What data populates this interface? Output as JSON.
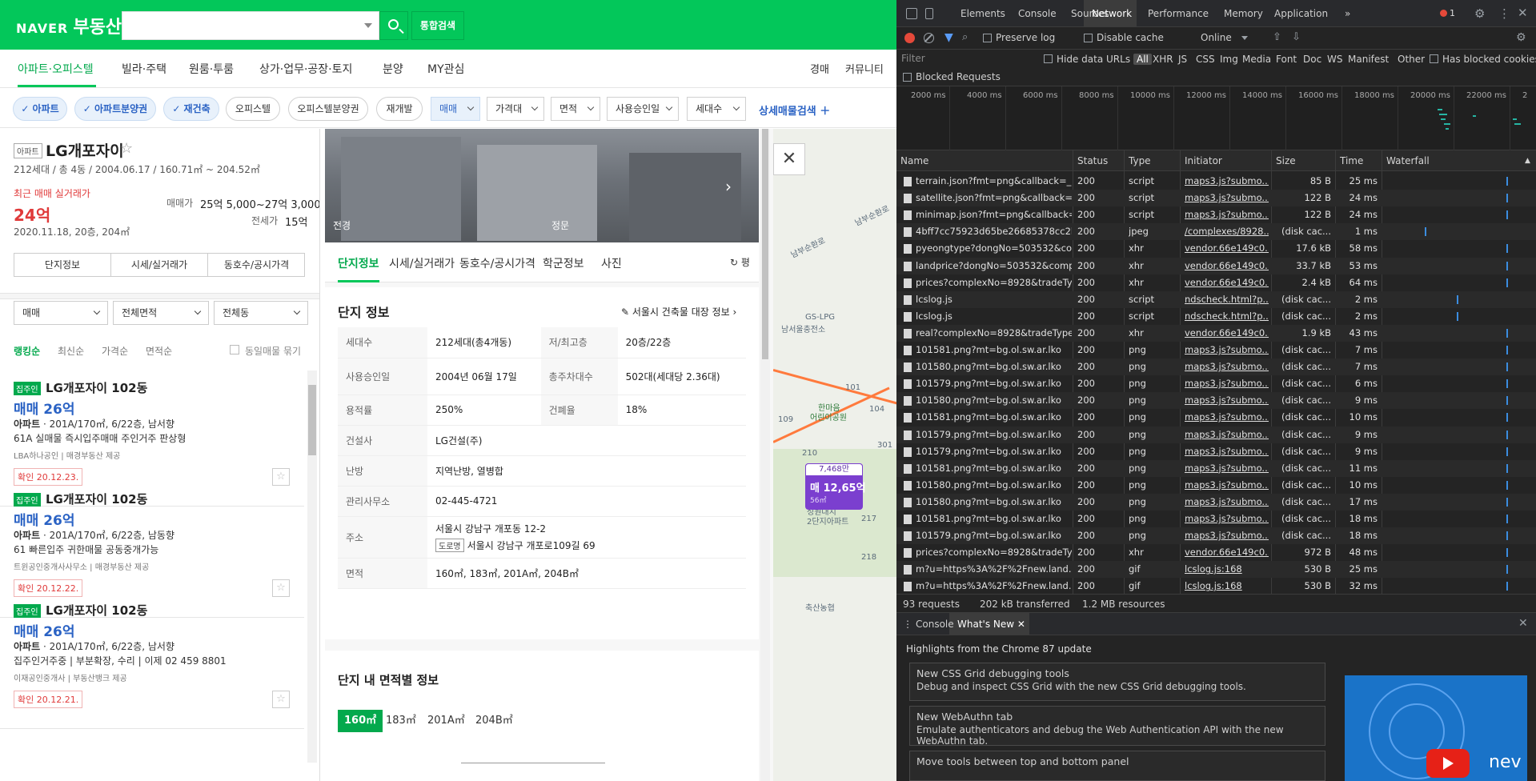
{
  "header": {
    "logo_naver": "NAVER",
    "logo_service": "부동산",
    "search_placeholder": "",
    "unified_search": "통합검색"
  },
  "nav": {
    "tabs": [
      "아파트·오피스텔",
      "빌라·주택",
      "원룸·투룸",
      "상가·업무·공장·토지",
      "분양",
      "MY관심"
    ],
    "right": [
      "경매",
      "커뮤니티"
    ]
  },
  "filters": {
    "chips": [
      {
        "label": "아파트",
        "on": true
      },
      {
        "label": "아파트분양권",
        "on": true
      },
      {
        "label": "재건축",
        "on": true
      },
      {
        "label": "오피스텔",
        "on": false
      },
      {
        "label": "오피스텔분양권",
        "on": false
      },
      {
        "label": "재개발",
        "on": false
      }
    ],
    "dropdowns": [
      "매매",
      "가격대",
      "면적",
      "사용승인일",
      "세대수"
    ],
    "detail_search": "상세매물검색"
  },
  "complex": {
    "badge": "아파트",
    "name": "LG개포자이",
    "info": "212세대 / 총 4동 / 2004.06.17 / 160.71㎡ ~ 204.52㎡",
    "recent_label": "최근 매매 실거래가",
    "recent_price": "24억",
    "recent_date": "2020.11.18, 20층, 204㎡",
    "sale_label": "매매가",
    "sale_value": "25억 5,000~27억 3,000",
    "jeonse_label": "전세가",
    "jeonse_value": "15억",
    "info_tabs": [
      "단지정보",
      "시세/실거래가",
      "동호수/공시가격"
    ]
  },
  "list_filters": {
    "selects": [
      "매매",
      "전체면적",
      "전체동"
    ],
    "sorts": [
      "랭킹순",
      "최신순",
      "가격순",
      "면적순"
    ],
    "same_label": "동일매물 묶기"
  },
  "listings": [
    {
      "badge": "집주인",
      "title": "LG개포자이 102동",
      "price": "매매 26억",
      "spec_type": "아파트",
      "spec": " · 201A/170㎡, 6/22층, 남서향",
      "desc": "61A 실매물 즉시입주매매 주인거주 판상형",
      "agent": "LBA하나공인 | 매경부동산 제공",
      "confirm": "확인 20.12.23."
    },
    {
      "badge": "집주인",
      "title": "LG개포자이 102동",
      "price": "매매 26억",
      "spec_type": "아파트",
      "spec": " · 201A/170㎡, 6/22층, 남동향",
      "desc": "61 빠른입주 귀한매물 공동중개가능",
      "agent": "트윈공인중개사사무소 | 매경부동산 제공",
      "confirm": "확인 20.12.22."
    },
    {
      "badge": "집주인",
      "title": "LG개포자이 102동",
      "price": "매매 26억",
      "spec_type": "아파트",
      "spec": " · 201A/170㎡, 6/22층, 남서향",
      "desc": "집주인거주중 | 부분확장, 수리 | 이제 02 459 8801",
      "agent": "이재공인중개사 | 부동산뱅크 제공",
      "confirm": "확인 20.12.21."
    }
  ],
  "detail": {
    "photo_labels": [
      "전경",
      "정문"
    ],
    "tabs": [
      "단지정보",
      "시세/실거래가",
      "동호수/공시가격",
      "학군정보",
      "사진"
    ],
    "refresh": "평",
    "section_title": "단지 정보",
    "section_link": "서울시 건축물 대장 정보",
    "rows": [
      {
        "k": "세대수",
        "v": "212세대(총4개동)",
        "k2": "저/최고층",
        "v2": "20층/22층"
      },
      {
        "k": "사용승인일",
        "v": "2004년 06월 17일",
        "k2": "총주차대수",
        "v2": "502대(세대당 2.36대)"
      },
      {
        "k": "용적률",
        "v": "250%",
        "k2": "건폐율",
        "v2": "18%"
      },
      {
        "k": "건설사",
        "v": "LG건설(주)"
      },
      {
        "k": "난방",
        "v": "지역난방, 열병합"
      },
      {
        "k": "관리사무소",
        "v": "02-445-4721"
      },
      {
        "k": "주소",
        "v": "서울시 강남구 개포동 12-2",
        "road_badge": "도로명",
        "road": "서울시 강남구 개포로109길 69"
      },
      {
        "k": "면적",
        "v": "160㎡, 183㎡, 201A㎡, 204B㎡"
      }
    ],
    "area_title": "단지 내 면적별 정보",
    "area_tabs": [
      "160㎡",
      "183㎡",
      "201A㎡",
      "204B㎡"
    ]
  },
  "map": {
    "labels": [
      "남부순환로",
      "남부순환로",
      "GS-LPG",
      "남서울충전소",
      "101",
      "한마음",
      "어린이공원",
      "104",
      "109",
      "210",
      "301",
      "성원대치",
      "2단지아파트",
      "217",
      "218",
      "축산농협"
    ],
    "marker_top": "7,468만",
    "marker_price": "매 12,65억",
    "marker_area": "56㎡"
  },
  "devtools": {
    "tabs": [
      "Elements",
      "Console",
      "Sources",
      "Network",
      "Performance",
      "Memory",
      "Application"
    ],
    "active_tab": "Network",
    "error_count": "1",
    "toolbar": {
      "preserve_log": "Preserve log",
      "disable_cache": "Disable cache",
      "throttle": "Online"
    },
    "filterbar": {
      "placeholder": "Filter",
      "hide_data_urls": "Hide data URLs",
      "types": [
        "All",
        "XHR",
        "JS",
        "CSS",
        "Img",
        "Media",
        "Font",
        "Doc",
        "WS",
        "Manifest",
        "Other"
      ],
      "has_blocked": "Has blocked cookies"
    },
    "blocked_requests": "Blocked Requests",
    "overview_ticks": [
      "2000 ms",
      "4000 ms",
      "6000 ms",
      "8000 ms",
      "10000 ms",
      "12000 ms",
      "14000 ms",
      "16000 ms",
      "18000 ms",
      "20000 ms",
      "22000 ms",
      "2"
    ],
    "columns": [
      "Name",
      "Status",
      "Type",
      "Initiator",
      "Size",
      "Time",
      "Waterfall"
    ],
    "requests": [
      {
        "name": "terrain.json?fmt=png&callback=_...",
        "status": "200",
        "type": "script",
        "initiator": "maps3.js?submo...",
        "size": "85 B",
        "time": "25 ms"
      },
      {
        "name": "satellite.json?fmt=png&callback=_...",
        "status": "200",
        "type": "script",
        "initiator": "maps3.js?submo...",
        "size": "122 B",
        "time": "24 ms"
      },
      {
        "name": "minimap.json?fmt=png&callback=...",
        "status": "200",
        "type": "script",
        "initiator": "maps3.js?submo...",
        "size": "122 B",
        "time": "24 ms"
      },
      {
        "name": "4bff7cc75923d65be26685378cc2b...",
        "status": "200",
        "type": "jpeg",
        "initiator": "/complexes/8928...",
        "size": "(disk cac...",
        "time": "1 ms"
      },
      {
        "name": "pyeongtype?dongNo=503532&co...",
        "status": "200",
        "type": "xhr",
        "initiator": "vendor.66e149c0...",
        "size": "17.6 kB",
        "time": "58 ms"
      },
      {
        "name": "landprice?dongNo=503532&comp...",
        "status": "200",
        "type": "xhr",
        "initiator": "vendor.66e149c0...",
        "size": "33.7 kB",
        "time": "53 ms"
      },
      {
        "name": "prices?complexNo=8928&tradeTy...",
        "status": "200",
        "type": "xhr",
        "initiator": "vendor.66e149c0...",
        "size": "2.4 kB",
        "time": "64 ms"
      },
      {
        "name": "lcslog.js",
        "status": "200",
        "type": "script",
        "initiator": "ndscheck.html?p...",
        "size": "(disk cac...",
        "time": "2 ms"
      },
      {
        "name": "lcslog.js",
        "status": "200",
        "type": "script",
        "initiator": "ndscheck.html?p...",
        "size": "(disk cac...",
        "time": "2 ms"
      },
      {
        "name": "real?complexNo=8928&tradeType...",
        "status": "200",
        "type": "xhr",
        "initiator": "vendor.66e149c0...",
        "size": "1.9 kB",
        "time": "43 ms"
      },
      {
        "name": "101581.png?mt=bg.ol.sw.ar.lko",
        "status": "200",
        "type": "png",
        "initiator": "maps3.js?submo...",
        "size": "(disk cac...",
        "time": "7 ms"
      },
      {
        "name": "101580.png?mt=bg.ol.sw.ar.lko",
        "status": "200",
        "type": "png",
        "initiator": "maps3.js?submo...",
        "size": "(disk cac...",
        "time": "7 ms"
      },
      {
        "name": "101579.png?mt=bg.ol.sw.ar.lko",
        "status": "200",
        "type": "png",
        "initiator": "maps3.js?submo...",
        "size": "(disk cac...",
        "time": "6 ms"
      },
      {
        "name": "101580.png?mt=bg.ol.sw.ar.lko",
        "status": "200",
        "type": "png",
        "initiator": "maps3.js?submo...",
        "size": "(disk cac...",
        "time": "9 ms"
      },
      {
        "name": "101581.png?mt=bg.ol.sw.ar.lko",
        "status": "200",
        "type": "png",
        "initiator": "maps3.js?submo...",
        "size": "(disk cac...",
        "time": "10 ms"
      },
      {
        "name": "101579.png?mt=bg.ol.sw.ar.lko",
        "status": "200",
        "type": "png",
        "initiator": "maps3.js?submo...",
        "size": "(disk cac...",
        "time": "9 ms"
      },
      {
        "name": "101579.png?mt=bg.ol.sw.ar.lko",
        "status": "200",
        "type": "png",
        "initiator": "maps3.js?submo...",
        "size": "(disk cac...",
        "time": "9 ms"
      },
      {
        "name": "101581.png?mt=bg.ol.sw.ar.lko",
        "status": "200",
        "type": "png",
        "initiator": "maps3.js?submo...",
        "size": "(disk cac...",
        "time": "11 ms"
      },
      {
        "name": "101580.png?mt=bg.ol.sw.ar.lko",
        "status": "200",
        "type": "png",
        "initiator": "maps3.js?submo...",
        "size": "(disk cac...",
        "time": "10 ms"
      },
      {
        "name": "101580.png?mt=bg.ol.sw.ar.lko",
        "status": "200",
        "type": "png",
        "initiator": "maps3.js?submo...",
        "size": "(disk cac...",
        "time": "17 ms"
      },
      {
        "name": "101581.png?mt=bg.ol.sw.ar.lko",
        "status": "200",
        "type": "png",
        "initiator": "maps3.js?submo...",
        "size": "(disk cac...",
        "time": "18 ms"
      },
      {
        "name": "101579.png?mt=bg.ol.sw.ar.lko",
        "status": "200",
        "type": "png",
        "initiator": "maps3.js?submo...",
        "size": "(disk cac...",
        "time": "18 ms"
      },
      {
        "name": "prices?complexNo=8928&tradeTy...",
        "status": "200",
        "type": "xhr",
        "initiator": "vendor.66e149c0...",
        "size": "972 B",
        "time": "48 ms"
      },
      {
        "name": "m?u=https%3A%2F%2Fnew.land.n...",
        "status": "200",
        "type": "gif",
        "initiator": "lcslog.js:168",
        "size": "530 B",
        "time": "25 ms"
      },
      {
        "name": "m?u=https%3A%2F%2Fnew.land.n...",
        "status": "200",
        "type": "gif",
        "initiator": "lcslog.js:168",
        "size": "530 B",
        "time": "32 ms"
      }
    ],
    "status_bar": [
      "93 requests",
      "202 kB transferred",
      "1.2 MB resources"
    ],
    "drawer_tabs": [
      "Console",
      "What's New"
    ],
    "whatsnew": {
      "headline": "Highlights from the Chrome 87 update",
      "cards": [
        {
          "title": "New CSS Grid debugging tools",
          "desc": "Debug and inspect CSS Grid with the new CSS Grid debugging tools."
        },
        {
          "title": "New WebAuthn tab",
          "desc": "Emulate authenticators and debug the Web Authentication API with the new WebAuthn tab."
        },
        {
          "title": "Move tools between top and bottom panel",
          "desc": ""
        }
      ],
      "video_text": "nev"
    }
  }
}
